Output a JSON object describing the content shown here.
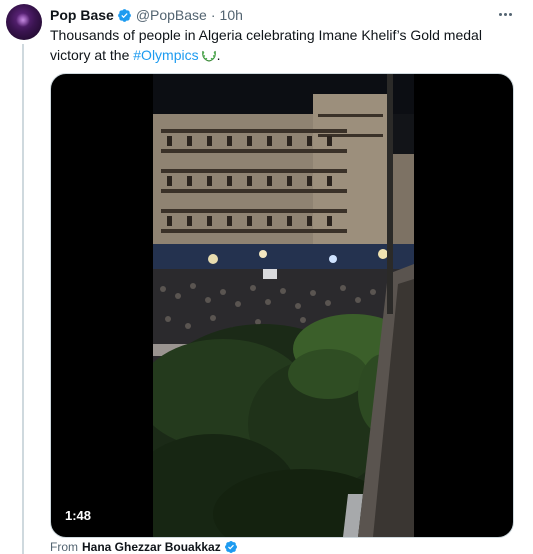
{
  "post": {
    "author_name": "Pop Base",
    "handle": "@PopBase",
    "separator": "·",
    "timestamp": "10h",
    "text_main": "Thousands of people in Algeria celebrating Imane Khelif’s Gold medal victory at the",
    "hashtag": "#Olympics",
    "text_end": ".",
    "icons": {
      "verified": "verified-badge-icon",
      "more": "more-options-icon",
      "olympics": "olympics-wreath-icon"
    }
  },
  "media": {
    "duration": "1:48"
  },
  "attribution": {
    "prefix": "From",
    "author": "Hana Ghezzar Bouakkaz"
  },
  "colors": {
    "link": "#1d9bf0",
    "verified": "#1d9bf0",
    "secondary_text": "#536471"
  }
}
